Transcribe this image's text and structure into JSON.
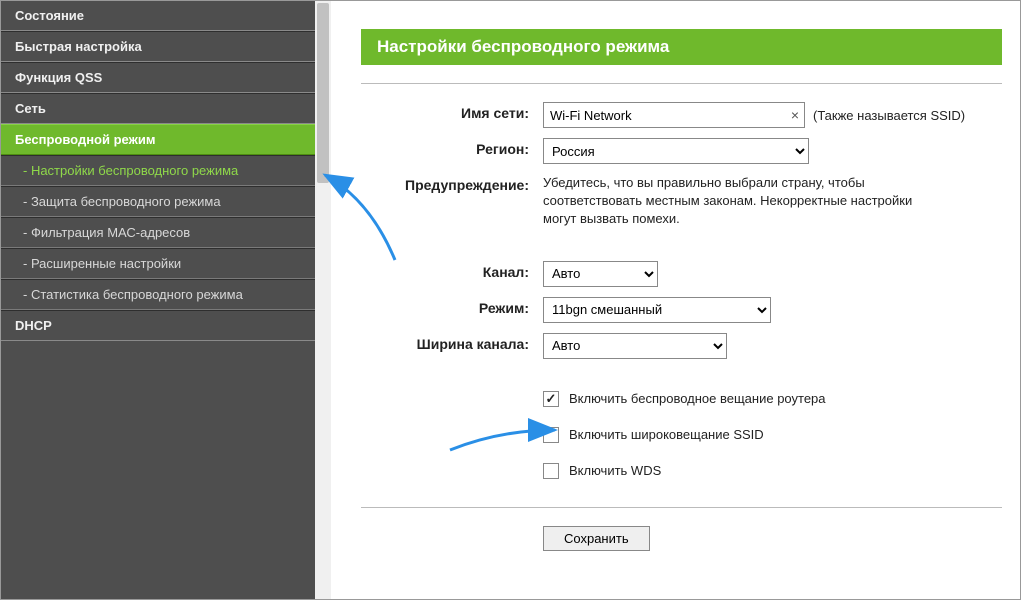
{
  "sidebar": {
    "items": [
      {
        "label": "Состояние"
      },
      {
        "label": "Быстрая настройка"
      },
      {
        "label": "Функция QSS"
      },
      {
        "label": "Сеть"
      },
      {
        "label": "Беспроводной режим"
      },
      {
        "label": "DHCP"
      }
    ],
    "sub_items": [
      {
        "label": "- Настройки беспроводного режима"
      },
      {
        "label": "- Защита беспроводного режима"
      },
      {
        "label": "- Фильтрация МАС-адресов"
      },
      {
        "label": "- Расширенные настройки"
      },
      {
        "label": "- Статистика беспроводного режима"
      }
    ]
  },
  "page": {
    "title": "Настройки беспроводного режима"
  },
  "form": {
    "ssid_label": "Имя сети:",
    "ssid_value": "Wi-Fi Network",
    "ssid_hint": "(Также называется SSID)",
    "region_label": "Регион:",
    "region_value": "Россия",
    "warning_label": "Предупреждение:",
    "warning_text": "Убедитесь, что вы правильно выбрали страну, чтобы соответствовать местным законам. Некорректные настройки могут вызвать помехи.",
    "channel_label": "Канал:",
    "channel_value": "Авто",
    "mode_label": "Режим:",
    "mode_value": "11bgn смешанный",
    "width_label": "Ширина канала:",
    "width_value": "Авто",
    "cb_broadcast_label": "Включить беспроводное вещание роутера",
    "cb_ssid_label": "Включить широковещание SSID",
    "cb_wds_label": "Включить WDS",
    "save_label": "Сохранить"
  }
}
